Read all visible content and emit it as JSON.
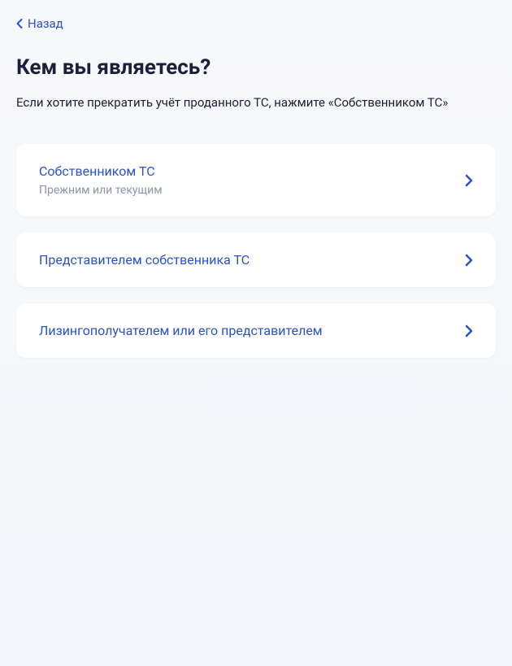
{
  "back_link": {
    "label": "Назад"
  },
  "page": {
    "title": "Кем вы являетесь?",
    "description": "Если хотите прекратить учёт проданного ТС, нажмите «Собственником ТС»"
  },
  "options": [
    {
      "title": "Собственником ТС",
      "subtitle": "Прежним или текущим"
    },
    {
      "title": "Представителем собственника ТС",
      "subtitle": ""
    },
    {
      "title": "Лизингополучателем или его представителем",
      "subtitle": ""
    }
  ]
}
